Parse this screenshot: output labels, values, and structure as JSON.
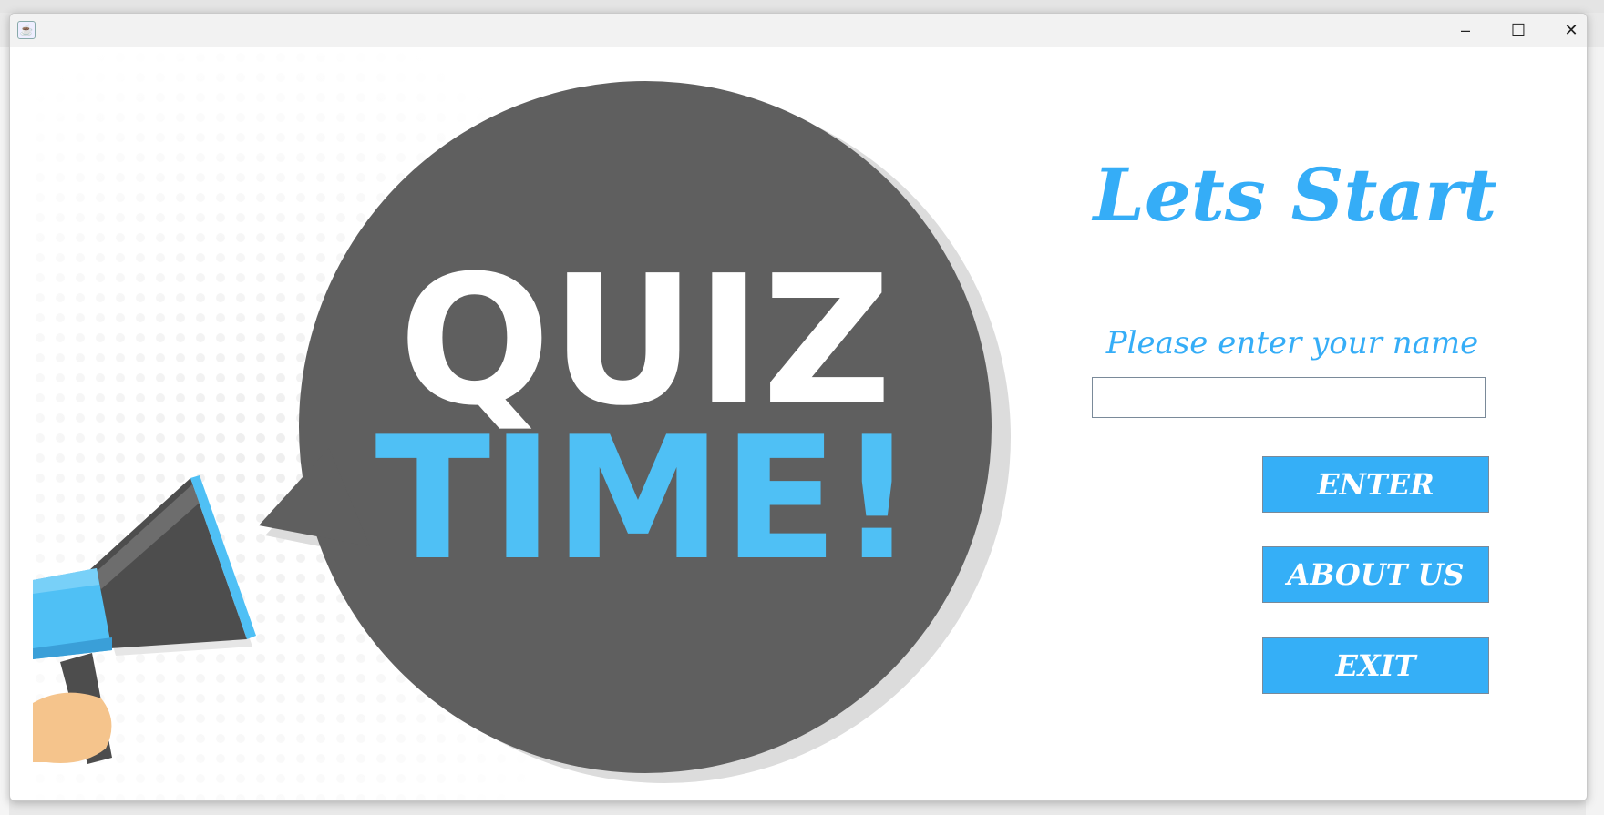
{
  "window": {
    "app_icon": "java-cup-icon",
    "minimize": "–",
    "maximize": "☐",
    "close": "✕"
  },
  "illustration": {
    "line1": "QUIZ",
    "line2": "TIME!"
  },
  "main": {
    "title": "Lets Start",
    "prompt": "Please enter your name",
    "name_value": "",
    "buttons": {
      "enter": "ENTER",
      "about": "ABOUT US",
      "exit": "EXIT"
    }
  },
  "colors": {
    "accent": "#35aff7",
    "bubble": "#5f5f5f",
    "time_text": "#4fc0f5"
  }
}
